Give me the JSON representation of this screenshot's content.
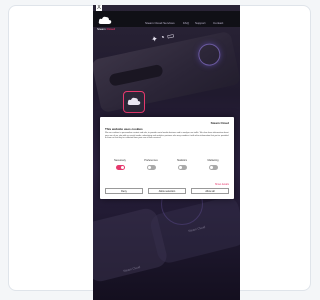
{
  "site": {
    "brand_primary": "Steam",
    "brand_accent": "Cloud",
    "nav": [
      "Steam Cloud Services",
      "FAQ",
      "Support",
      "Contact"
    ],
    "close_label": "X"
  },
  "cookie_modal": {
    "brand": "Steam Cloud",
    "title": "This website uses cookies",
    "body": "We use cookies to personalise content and ads, to provide social media features and to analyse our traffic. We also share information about your use of our site with our social media, advertising and analytics partners who may combine it with other information that you’ve provided to them or that they’ve collected from your use of their services.",
    "toggles": [
      {
        "label": "Necessary",
        "on": true
      },
      {
        "label": "Preferences",
        "on": false
      },
      {
        "label": "Statistics",
        "on": false
      },
      {
        "label": "Marketing",
        "on": false
      }
    ],
    "details_link": "Show details",
    "buttons": [
      "Deny",
      "Allow selection",
      "Allow all"
    ]
  },
  "colors": {
    "accent": "#e6396d",
    "bg_dark": "#201a2e"
  }
}
